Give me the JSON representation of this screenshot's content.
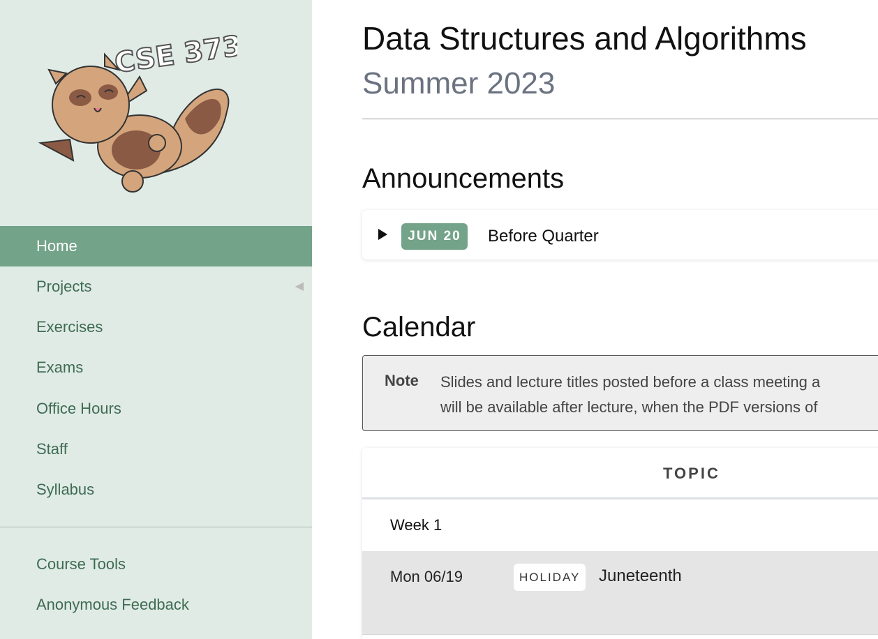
{
  "sidebar": {
    "logo_text": "CSE 373",
    "items": [
      {
        "label": "Home",
        "active": true
      },
      {
        "label": "Projects",
        "expandable": true
      },
      {
        "label": "Exercises"
      },
      {
        "label": "Exams"
      },
      {
        "label": "Office Hours"
      },
      {
        "label": "Staff"
      },
      {
        "label": "Syllabus"
      }
    ],
    "extra_items": [
      {
        "label": "Course Tools"
      },
      {
        "label": "Anonymous Feedback"
      }
    ],
    "accent_color": "#73a388"
  },
  "header": {
    "title": "Data Structures and Algorithms",
    "subtitle": "Summer 2023"
  },
  "announcements": {
    "heading": "Announcements",
    "items": [
      {
        "date": "JUN 20",
        "title": "Before Quarter",
        "expanded": false
      }
    ]
  },
  "calendar": {
    "heading": "Calendar",
    "note": {
      "label": "Note",
      "line1": "Slides and lecture titles posted before a class meeting a",
      "line2": "will be available after lecture, when the PDF versions of"
    },
    "columns": [
      "TOPIC"
    ],
    "weeks": [
      {
        "label": "Week 1",
        "rows": [
          {
            "date": "Mon 06/19",
            "badge": "HOLIDAY",
            "topic": "Juneteenth"
          }
        ]
      }
    ]
  }
}
